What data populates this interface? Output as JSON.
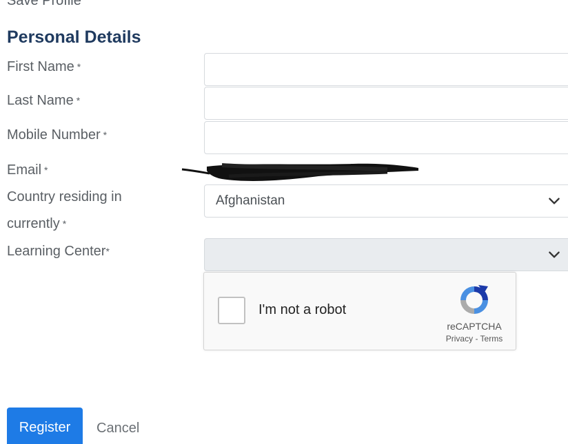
{
  "header": {
    "save_profile": "Save Profile",
    "section_title": "Personal Details"
  },
  "form": {
    "first_name_label": "First Name",
    "last_name_label": "Last Name",
    "mobile_label": "Mobile Number",
    "email_label": "Email",
    "country_label_line1": "Country residing in",
    "country_label_line2": "currently",
    "learning_center_label": "Learning Center",
    "required_marker": "*",
    "first_name_value": "",
    "last_name_value": "",
    "mobile_value": "",
    "country_selected": "Afghanistan",
    "learning_center_selected": ""
  },
  "captcha": {
    "checkbox_label": "I'm not a robot",
    "brand": "reCAPTCHA",
    "links": "Privacy - Terms"
  },
  "actions": {
    "register_label": "Register",
    "cancel_label": "Cancel"
  },
  "colors": {
    "primary": "#1e7be6",
    "heading": "#1f3a5f",
    "disabled_field": "#e9ecef"
  },
  "icons": [
    "chevron-down-icon",
    "recaptcha-logo-icon"
  ]
}
